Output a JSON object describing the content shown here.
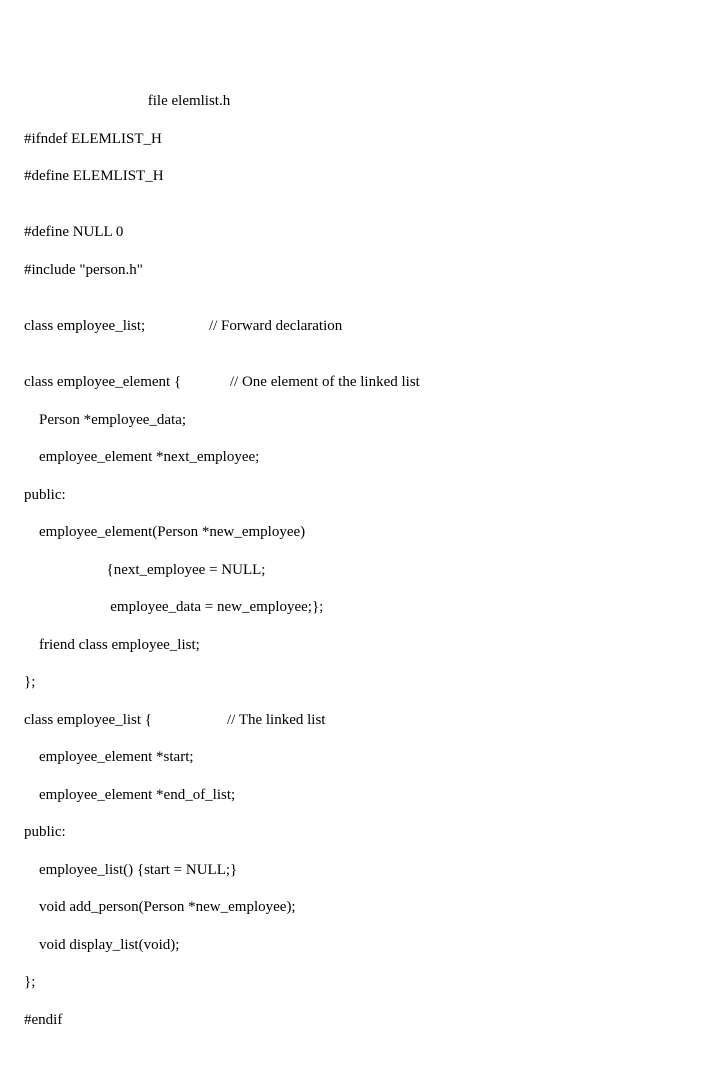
{
  "code": {
    "l01": "                                 file elemlist.h",
    "l02": "#ifndef ELEMLIST_H",
    "l03": "#define ELEMLIST_H",
    "l04": "",
    "l05": "#define NULL 0",
    "l06": "#include \"person.h\"",
    "l07": "",
    "l08": "class employee_list;                 // Forward declaration",
    "l09": "",
    "l10": "class employee_element {             // One element of the linked list",
    "l11": "    Person *employee_data;",
    "l12": "    employee_element *next_employee;",
    "l13": "public:",
    "l14": "    employee_element(Person *new_employee)",
    "l15": "                      {next_employee = NULL;",
    "l16": "                       employee_data = new_employee;};",
    "l17": "    friend class employee_list;",
    "l18": "};",
    "l19": "class employee_list {                    // The linked list",
    "l20": "    employee_element *start;",
    "l21": "    employee_element *end_of_list;",
    "l22": "public:",
    "l23": "    employee_list() {start = NULL;}",
    "l24": "    void add_person(Person *new_employee);",
    "l25": "    void display_list(void);",
    "l26": "};",
    "l27": "#endif"
  }
}
